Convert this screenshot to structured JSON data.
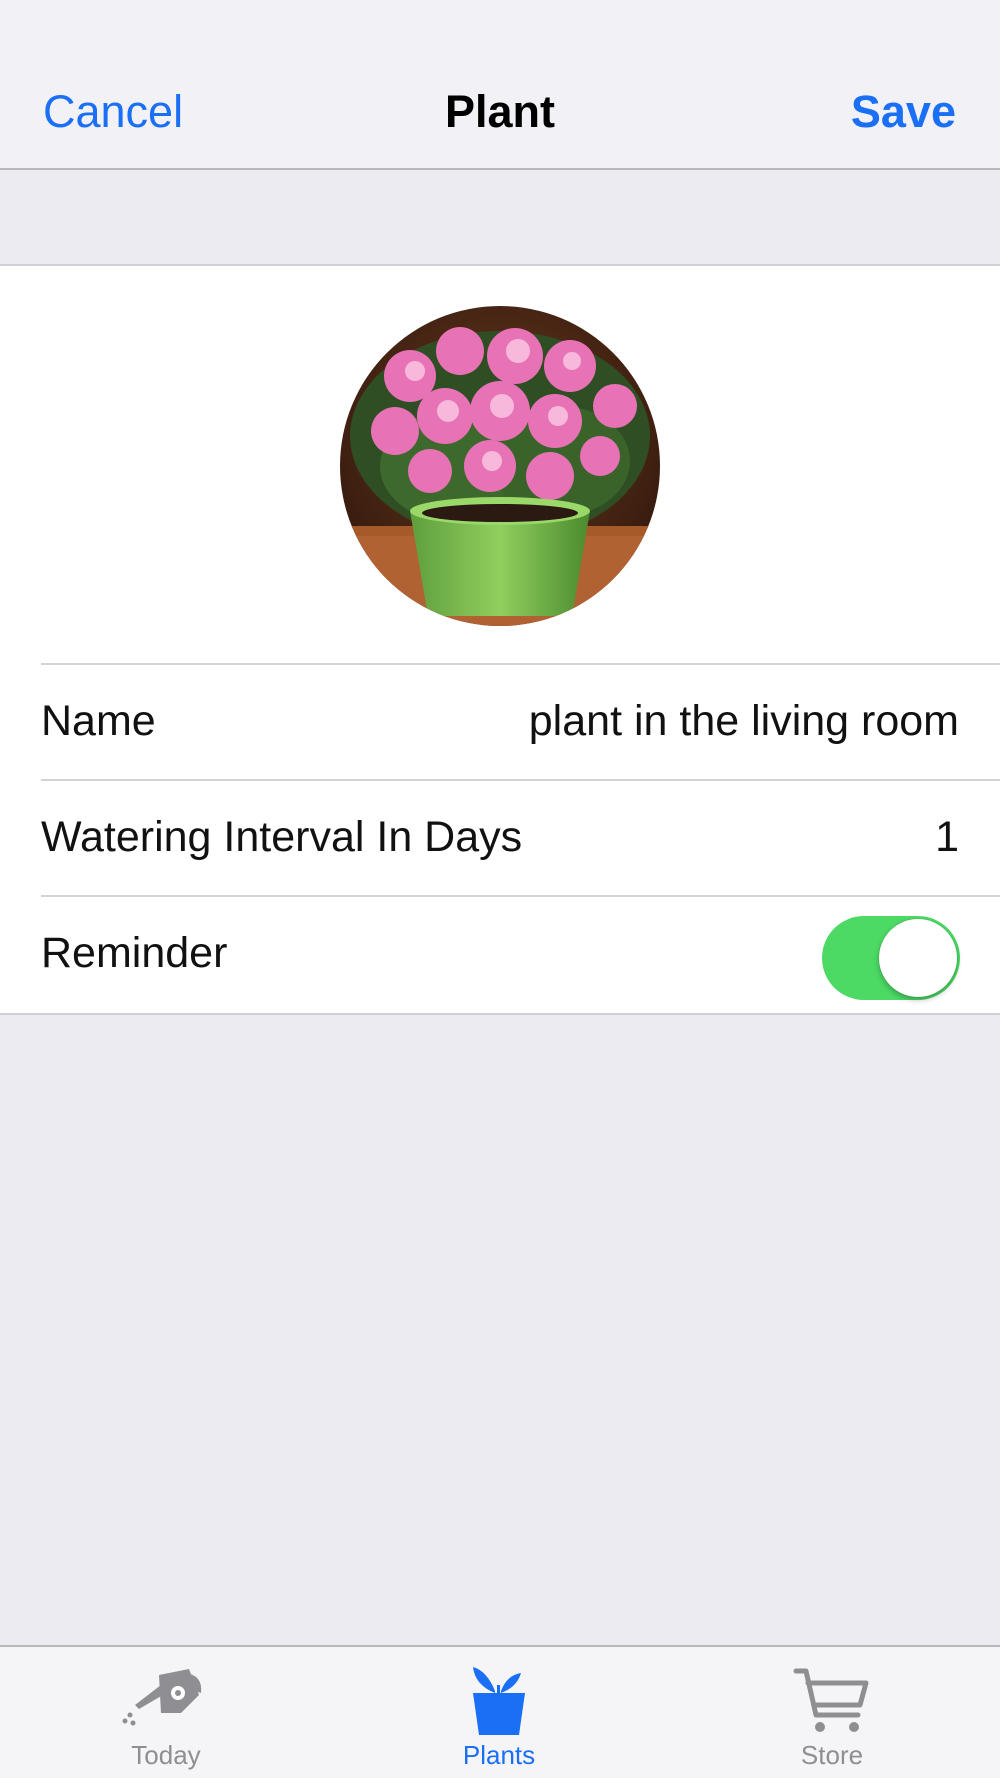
{
  "navbar": {
    "cancel_label": "Cancel",
    "title": "Plant",
    "save_label": "Save"
  },
  "form": {
    "photo": {
      "icon": "plant-photo",
      "description_only": true
    },
    "name": {
      "label": "Name",
      "value": "plant in the living room"
    },
    "watering_interval": {
      "label": "Watering Interval In Days",
      "value": "1"
    },
    "reminder": {
      "label": "Reminder",
      "enabled": true
    }
  },
  "tabs": [
    {
      "label": "Today",
      "icon": "watering-can-icon",
      "active": false
    },
    {
      "label": "Plants",
      "icon": "plant-pot-icon",
      "active": true
    },
    {
      "label": "Store",
      "icon": "cart-icon",
      "active": false
    }
  ],
  "colors": {
    "accent": "#1a6ff5",
    "toggle_on": "#4cd964",
    "tab_inactive": "#8e8e93",
    "background": "#ebebf1"
  }
}
